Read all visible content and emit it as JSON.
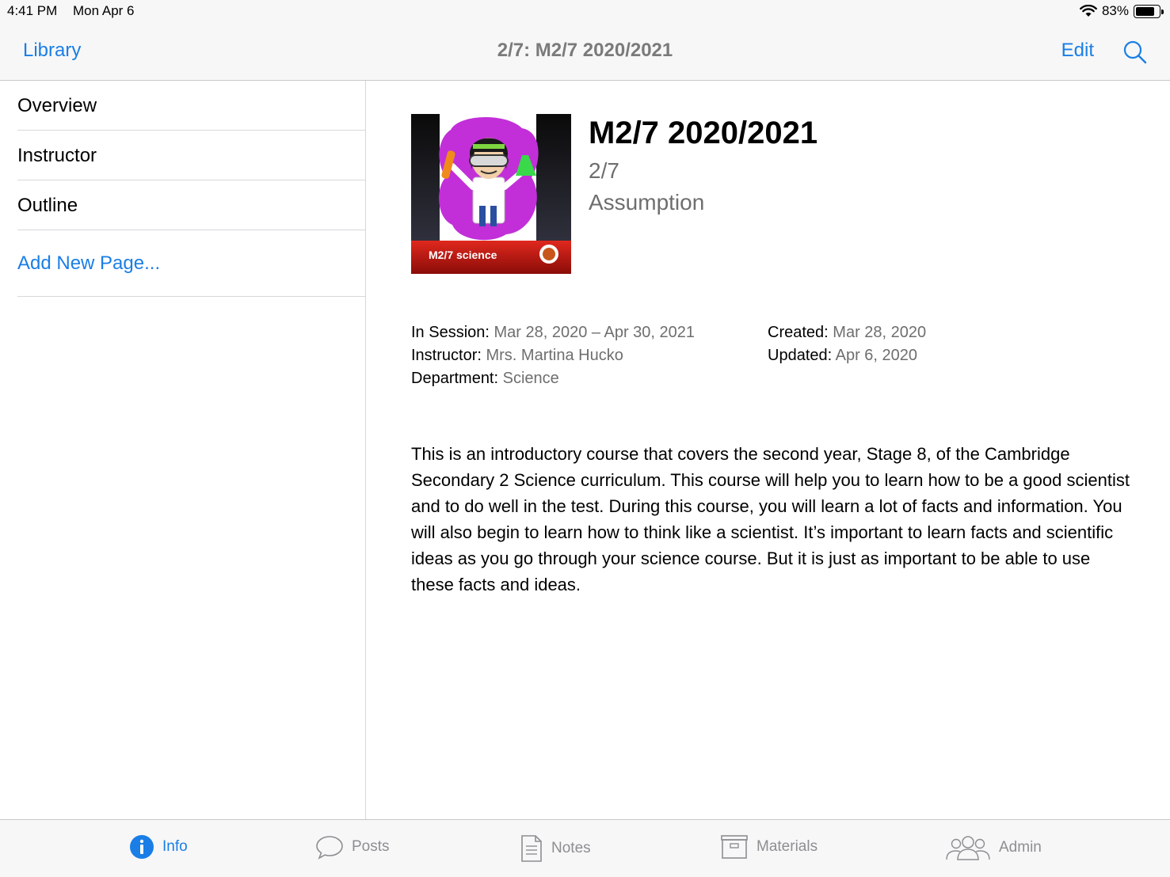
{
  "status_bar": {
    "time": "4:41 PM",
    "date": "Mon Apr 6",
    "battery": "83%",
    "battery_level": 0.83
  },
  "nav": {
    "back_label": "Library",
    "title": "2/7: M2/7 2020/2021",
    "edit_label": "Edit",
    "search_icon": "search-icon"
  },
  "sidebar": {
    "items": [
      {
        "label": "Overview"
      },
      {
        "label": "Instructor"
      },
      {
        "label": "Outline"
      }
    ],
    "add_page_label": "Add New Page..."
  },
  "course": {
    "cover_caption": "M2/7 science",
    "title": "M2/7 2020/2021",
    "code": "2/7",
    "school": "Assumption",
    "meta": {
      "session_label": "In Session:",
      "session_value": "Mar 28, 2020 – Apr 30, 2021",
      "instructor_label": "Instructor:",
      "instructor_value": "Mrs. Martina Hucko",
      "department_label": "Department:",
      "department_value": "Science",
      "created_label": "Created:",
      "created_value": "Mar 28, 2020",
      "updated_label": "Updated:",
      "updated_value": "Apr 6, 2020"
    },
    "description": "This is an introductory course that covers the second year, Stage 8, of the Cambridge Secondary 2 Science curriculum. This course will help you to learn how to be a good scientist and to do well in the test. During this course, you will learn a lot of facts and information. You will also begin to learn how to think like a scientist. It’s important to learn facts and scientific ideas as you go through your science course. But it is just as important to be able to use these facts and ideas."
  },
  "tabs": [
    {
      "label": "Info",
      "icon": "info-icon",
      "active": true
    },
    {
      "label": "Posts",
      "icon": "speech-bubble-icon"
    },
    {
      "label": "Notes",
      "icon": "document-icon"
    },
    {
      "label": "Materials",
      "icon": "archive-box-icon"
    },
    {
      "label": "Admin",
      "icon": "people-icon"
    }
  ],
  "colors": {
    "accent": "#1a7ee6",
    "secondary_text": "#6e6e6e",
    "bar_background": "#f7f7f7"
  }
}
